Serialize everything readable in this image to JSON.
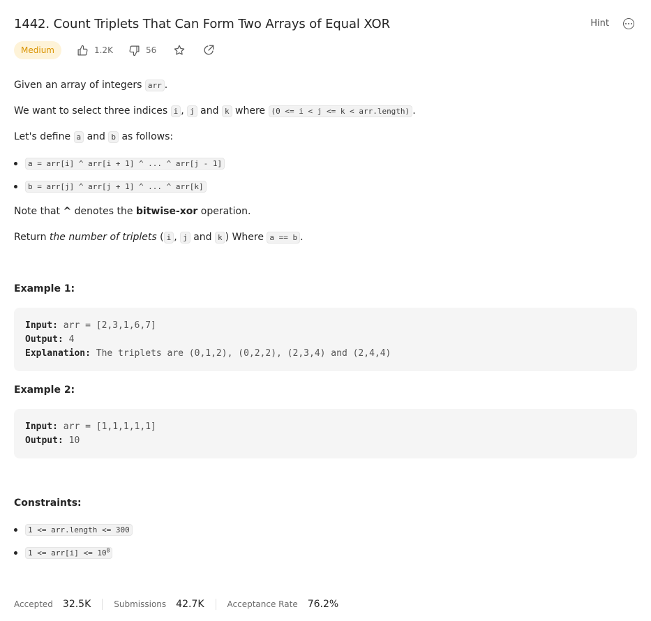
{
  "problem": {
    "title": "1442. Count Triplets That Can Form Two Arrays of Equal XOR",
    "difficulty": "Medium",
    "likes": "1.2K",
    "dislikes": "56",
    "hint_label": "Hint"
  },
  "description": {
    "p1_text": "Given an array of integers ",
    "p1_code": "arr",
    "p1_end": ".",
    "p2_text": "We want to select three indices ",
    "p2_i": "i",
    "p2_comma": ", ",
    "p2_j": "j",
    "p2_and": " and ",
    "p2_k": "k",
    "p2_where": " where ",
    "p2_cond": "(0 <= i < j <= k < arr.length)",
    "p2_end": ".",
    "p3_text": "Let's define ",
    "p3_a": "a",
    "p3_and": " and ",
    "p3_b": "b",
    "p3_end": " as follows:",
    "bullet_a": "a = arr[i] ^ arr[i + 1] ^ ... ^ arr[j - 1]",
    "bullet_b": "b = arr[j] ^ arr[j + 1] ^ ... ^ arr[k]",
    "note_pre": "Note that ",
    "note_caret": "^",
    "note_mid": " denotes the ",
    "note_bold": "bitwise-xor",
    "note_end": " operation.",
    "ret_pre": "Return ",
    "ret_em": "the number of triplets",
    "ret_open": " (",
    "ret_i": "i",
    "ret_comma": ", ",
    "ret_j": "j",
    "ret_and": " and ",
    "ret_k": "k",
    "ret_where": ") Where ",
    "ret_cond": "a == b",
    "ret_end": "."
  },
  "examples": [
    {
      "title": "Example 1:",
      "input_label": "Input:",
      "input": " arr = [2,3,1,6,7]",
      "output_label": "Output:",
      "output": " 4",
      "explanation_label": "Explanation:",
      "explanation": " The triplets are (0,1,2), (0,2,2), (2,3,4) and (2,4,4)"
    },
    {
      "title": "Example 2:",
      "input_label": "Input:",
      "input": " arr = [1,1,1,1,1]",
      "output_label": "Output:",
      "output": " 10"
    }
  ],
  "constraints": {
    "title": "Constraints:",
    "c1": "1 <= arr.length <= 300",
    "c2_base": "1 <= arr[i] <= 10",
    "c2_exp": "8"
  },
  "stats": {
    "accepted_label": "Accepted",
    "accepted": "32.5K",
    "submissions_label": "Submissions",
    "submissions": "42.7K",
    "rate_label": "Acceptance Rate",
    "rate": "76.2%"
  },
  "colors": {
    "medium_badge_bg": "#fef3d8",
    "medium_badge_text": "#d99300",
    "code_bg": "#f2f2f2",
    "example_bg": "#f5f5f5"
  }
}
